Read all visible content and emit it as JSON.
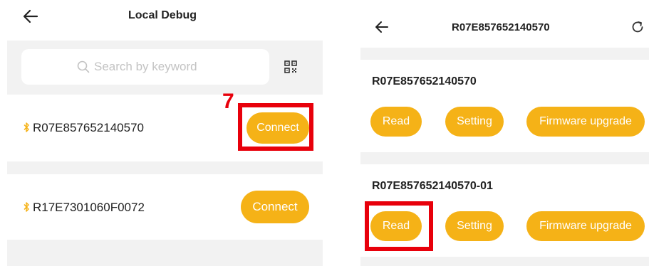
{
  "left_screen": {
    "header": {
      "title": "Local Debug",
      "back_icon": "back-arrow-icon"
    },
    "search": {
      "placeholder": "Search by keyword",
      "icon": "search-icon"
    },
    "scan_icon": "qr-scan-icon",
    "step_number": "7",
    "devices": [
      {
        "name": "R07E857652140570",
        "action": "Connect",
        "icon": "bluetooth-icon"
      },
      {
        "name": "R17E7301060F0072",
        "action": "Connect",
        "icon": "bluetooth-icon"
      }
    ]
  },
  "right_screen": {
    "header": {
      "title": "R07E857652140570",
      "back_icon": "back-arrow-icon",
      "refresh_icon": "refresh-icon"
    },
    "devices": [
      {
        "name": "R07E857652140570",
        "buttons": [
          "Read",
          "Setting",
          "Firmware upgrade"
        ]
      },
      {
        "name": "R07E857652140570-01",
        "buttons": [
          "Read",
          "Setting",
          "Firmware upgrade"
        ]
      }
    ]
  },
  "colors": {
    "accent": "#f5b217",
    "highlight": "#e8000b",
    "background_gray": "#f2f2f2"
  }
}
